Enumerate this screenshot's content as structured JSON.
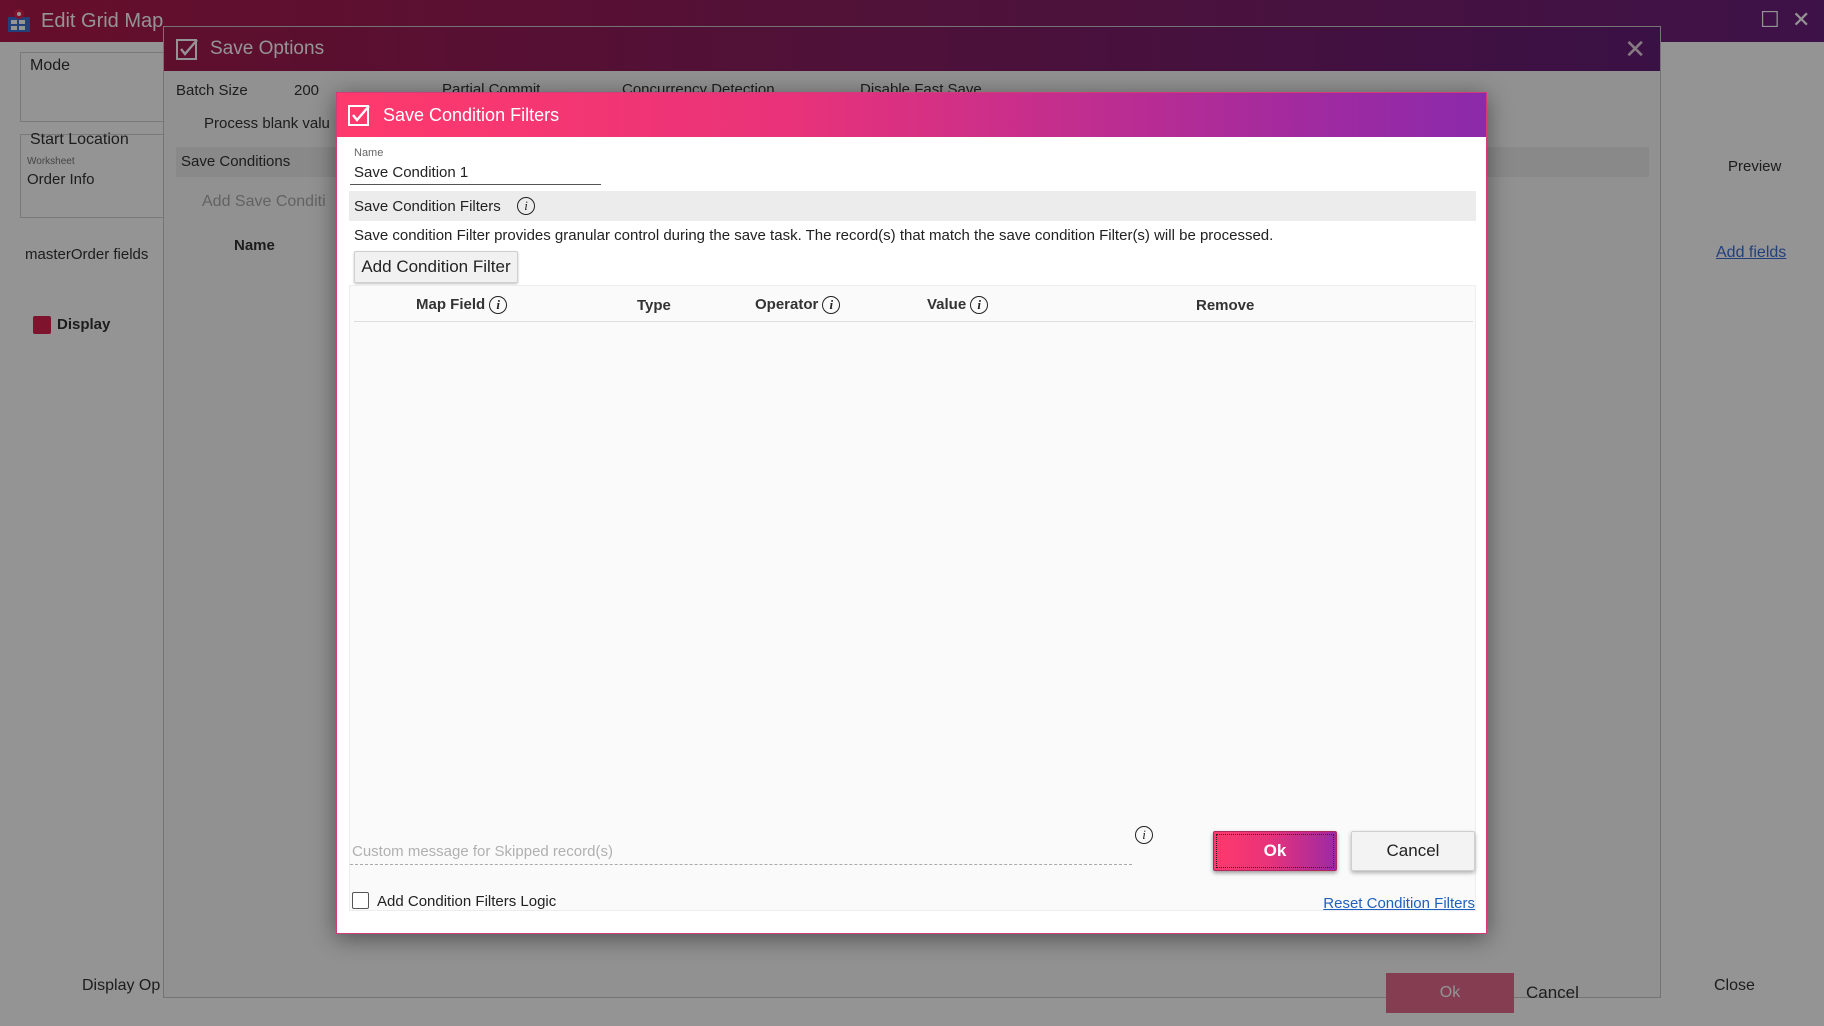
{
  "main_window": {
    "title": "Edit Grid Map",
    "mode_label": "Mode",
    "start_location_label": "Start Location",
    "worksheet_caption": "Worksheet",
    "start_location_value": "Order Info",
    "fields_label": "masterOrder fields",
    "display_label": "Display",
    "display_options_label": "Display Op",
    "close_label": "Close",
    "preview_label": "Preview",
    "add_fields_label": "Add fields"
  },
  "save_options": {
    "title": "Save Options",
    "batch_size_label": "Batch Size",
    "batch_size_value": "200",
    "partial_commit_label": "Partial Commit",
    "concurrency_label": "Concurrency Detection",
    "disable_fast_save_label": "Disable Fast Save",
    "process_blank_label": "Process blank valu",
    "save_conditions_label": "Save Conditions",
    "add_save_condition_label": "Add Save Conditi",
    "name_column": "Name",
    "ok_label": "Ok",
    "cancel_label": "Cancel"
  },
  "dialog": {
    "title": "Save Condition Filters",
    "name_caption": "Name",
    "name_value": "Save Condition 1",
    "section_title": "Save Condition Filters",
    "description": "Save condition Filter provides granular control during the save task. The record(s) that match the save condition Filter(s) will be processed.",
    "add_filter_button": "Add Condition Filter",
    "columns": {
      "map_field": "Map Field",
      "type": "Type",
      "operator": "Operator",
      "value": "Value",
      "remove": "Remove"
    },
    "custom_message_placeholder": "Custom message for Skipped record(s)",
    "ok_button": "Ok",
    "cancel_button": "Cancel",
    "logic_checkbox_label": "Add Condition Filters Logic",
    "logic_checked": false,
    "reset_link": "Reset Condition Filters"
  },
  "icons": {
    "app": "grid-map-icon",
    "title_check": "checkbox-icon",
    "info": "info-icon",
    "close": "close-icon",
    "maximize": "maximize-icon"
  },
  "colors": {
    "accent_pink": "#ff3a6c",
    "accent_purple": "#8b2aab",
    "link": "#1f5fbf"
  }
}
